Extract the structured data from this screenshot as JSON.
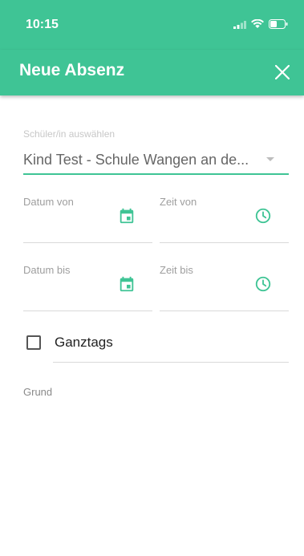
{
  "status_bar": {
    "time": "10:15"
  },
  "toolbar": {
    "title": "Neue Absenz"
  },
  "form": {
    "student_select": {
      "label": "Schüler/in auswählen",
      "value": "Kind Test - Schule Wangen an de..."
    },
    "date_from_label": "Datum von",
    "time_from_label": "Zeit von",
    "date_to_label": "Datum bis",
    "time_to_label": "Zeit bis",
    "fullday_label": "Ganztags",
    "fullday_checked": false,
    "reason_label": "Grund"
  },
  "colors": {
    "accent": "#3fc495",
    "icon": "#3fc495"
  }
}
